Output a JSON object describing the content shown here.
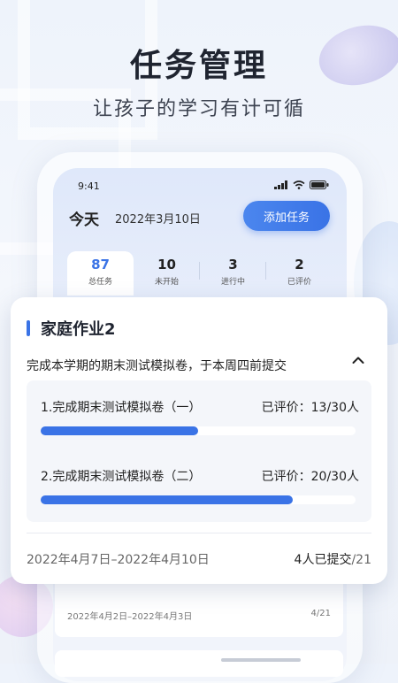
{
  "hero": {
    "title": "任务管理",
    "subtitle": "让孩子的学习有计可循"
  },
  "status_bar": {
    "time": "9:41"
  },
  "header": {
    "today": "今天",
    "date": "2022年3月10日",
    "add_button": "添加任务"
  },
  "stats": [
    {
      "value": "87",
      "label": "总任务"
    },
    {
      "value": "10",
      "label": "未开始"
    },
    {
      "value": "3",
      "label": "进行中"
    },
    {
      "value": "2",
      "label": "已评价"
    }
  ],
  "task_card": {
    "title": "家庭作业2",
    "description": "完成本学期的期末测试模拟卷，于本周四前提交",
    "items": [
      {
        "name": "1.完成期末测试模拟卷（一）",
        "evaluated": "已评价：13/30人",
        "progress": 0.5
      },
      {
        "name": "2.完成期末测试模拟卷（二）",
        "evaluated": "已评价：20/30人",
        "progress": 0.8
      }
    ],
    "date_range": "2022年4月7日–2022年4月10日",
    "submitted": "4人已提交",
    "total": "/21"
  },
  "next_card": {
    "date_range": "2022年4月2日–2022年4月3日",
    "count": "4",
    "total": "/21"
  },
  "colors": {
    "accent": "#3a73e6",
    "background": "#eef3fb"
  }
}
